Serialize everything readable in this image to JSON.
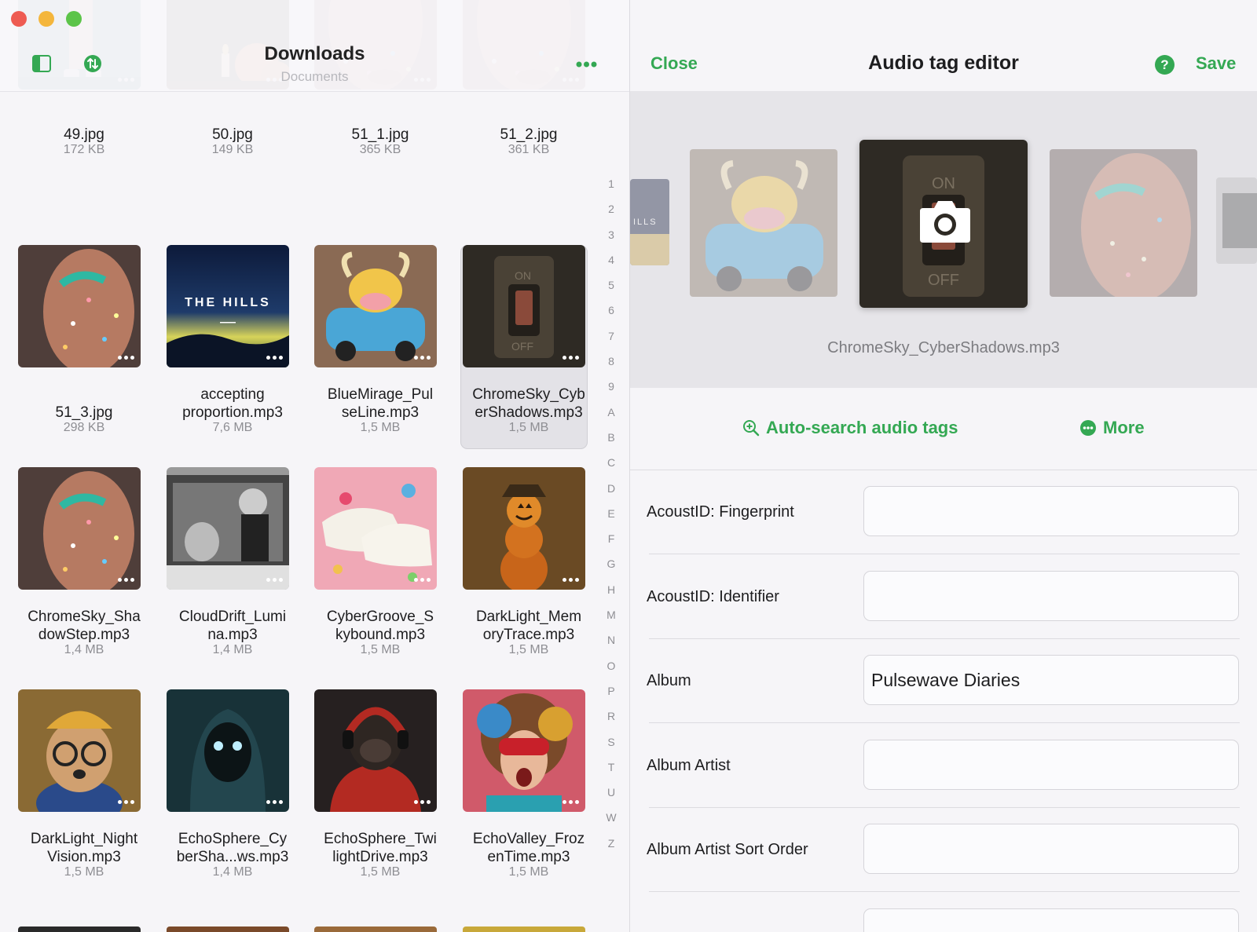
{
  "left_header": {
    "title": "Downloads",
    "subtitle": "Documents"
  },
  "files": [
    {
      "name": "49.jpg",
      "size": "172 KB",
      "thumb": "woman-legs-teal"
    },
    {
      "name": "50.jpg",
      "size": "149 KB",
      "thumb": "pumpkins-candle"
    },
    {
      "name": "51_1.jpg",
      "size": "365 KB",
      "thumb": "glitter-face-closeup"
    },
    {
      "name": "51_2.jpg",
      "size": "361 KB",
      "thumb": "glitter-face-closeup"
    },
    {
      "name": "51_3.jpg",
      "size": "298 KB",
      "thumb": "glitter-face"
    },
    {
      "name": "accepting proportion.mp3",
      "size": "7,6 MB",
      "thumb": "the-hills"
    },
    {
      "name": "BlueMirage_PulseLine.mp3",
      "size": "1,5 MB",
      "thumb": "bull-car"
    },
    {
      "name": "ChromeSky_CyberShadows.mp3",
      "size": "1,5 MB",
      "thumb": "light-switch",
      "selected": true
    },
    {
      "name": "ChromeSky_ShadowStep.mp3",
      "size": "1,4 MB",
      "thumb": "glitter-face"
    },
    {
      "name": "CloudDrift_Lumina.mp3",
      "size": "1,4 MB",
      "thumb": "car-cat-bw"
    },
    {
      "name": "CyberGroove_Skybound.mp3",
      "size": "1,5 MB",
      "thumb": "candy-sneakers"
    },
    {
      "name": "DarkLight_MemoryTrace.mp3",
      "size": "1,5 MB",
      "thumb": "pumpkin-scarecrow"
    },
    {
      "name": "DarkLight_NightVision.mp3",
      "size": "1,5 MB",
      "thumb": "dog-glasses"
    },
    {
      "name": "EchoSphere_CyberSha...ws.mp3",
      "size": "1,4 MB",
      "thumb": "hooded-figure"
    },
    {
      "name": "EchoSphere_TwilightDrive.mp3",
      "size": "1,5 MB",
      "thumb": "gorilla-headphones"
    },
    {
      "name": "EchoValley_FrozenTime.mp3",
      "size": "1,5 MB",
      "thumb": "curly-woman-goggles"
    }
  ],
  "file_name_lines": [
    [
      "49.jpg"
    ],
    [
      "50.jpg"
    ],
    [
      "51_1.jpg"
    ],
    [
      "51_2.jpg"
    ],
    [
      "51_3.jpg"
    ],
    [
      "accepting",
      "proportion.mp3"
    ],
    [
      "BlueMirage_Pul",
      "seLine.mp3"
    ],
    [
      "ChromeSky_Cyb",
      "erShadows.mp3"
    ],
    [
      "ChromeSky_Sha",
      "dowStep.mp3"
    ],
    [
      "CloudDrift_Lumi",
      "na.mp3"
    ],
    [
      "CyberGroove_S",
      "kybound.mp3"
    ],
    [
      "DarkLight_Mem",
      "oryTrace.mp3"
    ],
    [
      "DarkLight_Night",
      "Vision.mp3"
    ],
    [
      "EchoSphere_Cy",
      "berSha...ws.mp3"
    ],
    [
      "EchoSphere_Twi",
      "lightDrive.mp3"
    ],
    [
      "EchoValley_Froz",
      "enTime.mp3"
    ]
  ],
  "alphabet_index": [
    "1",
    "2",
    "3",
    "4",
    "5",
    "6",
    "7",
    "8",
    "9",
    "A",
    "B",
    "C",
    "D",
    "E",
    "F",
    "G",
    "H",
    "M",
    "N",
    "O",
    "P",
    "R",
    "S",
    "T",
    "U",
    "W",
    "Z"
  ],
  "editor": {
    "close_label": "Close",
    "title": "Audio tag editor",
    "help_label": "?",
    "save_label": "Save",
    "cover_filename": "ChromeSky_CyberShadows.mp3",
    "cover_side_text": "ILLS",
    "auto_search_label": "Auto-search audio tags",
    "more_label": "More"
  },
  "tag_fields": [
    {
      "label": "AcoustID: Fingerprint",
      "value": ""
    },
    {
      "label": "AcoustID: Identifier",
      "value": ""
    },
    {
      "label": "Album",
      "value": "Pulsewave Diaries"
    },
    {
      "label": "Album Artist",
      "value": ""
    },
    {
      "label": "Album Artist Sort Order",
      "value": ""
    }
  ],
  "colors": {
    "accent": "#34a853",
    "background": "#f6f5f8",
    "muted_text": "#8e8e93"
  }
}
